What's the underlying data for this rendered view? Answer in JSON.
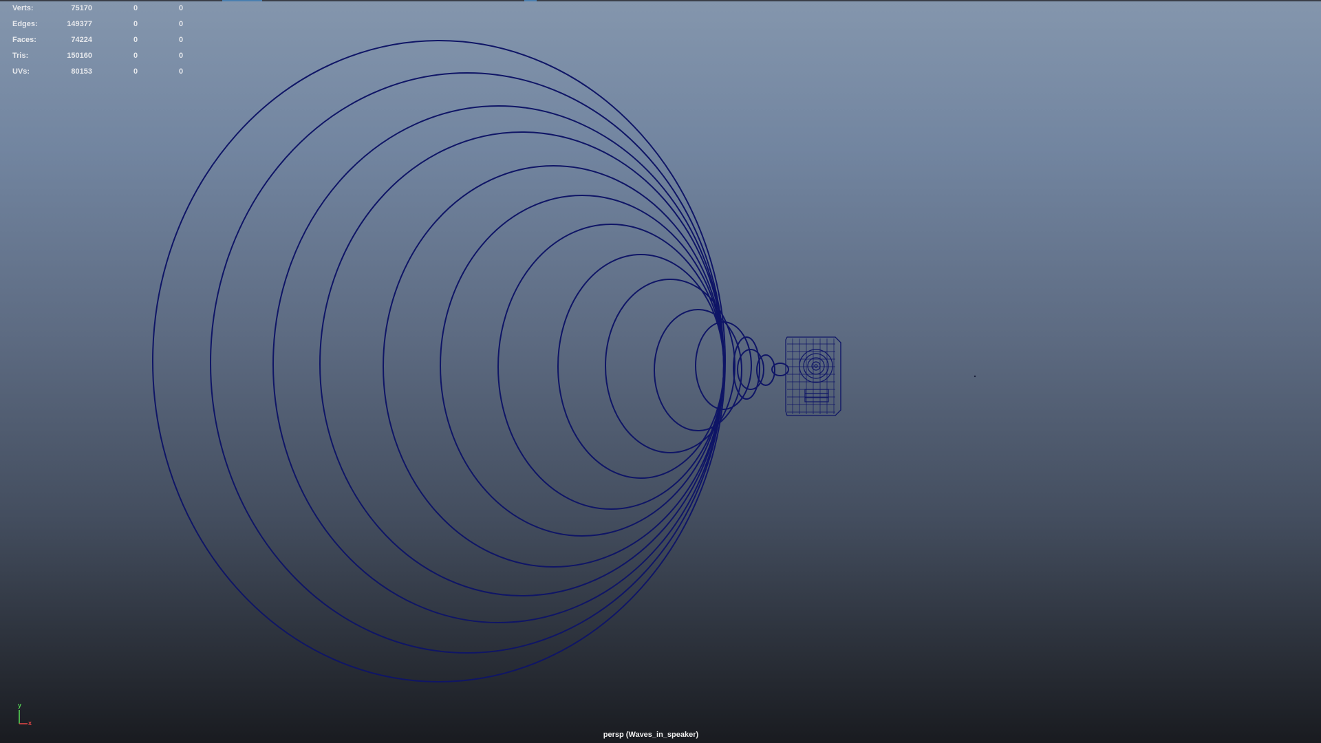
{
  "hud": {
    "rows": [
      {
        "label": "Verts:",
        "total": "75170",
        "selected": "0",
        "component": "0"
      },
      {
        "label": "Edges:",
        "total": "149377",
        "selected": "0",
        "component": "0"
      },
      {
        "label": "Faces:",
        "total": "74224",
        "selected": "0",
        "component": "0"
      },
      {
        "label": "Tris:",
        "total": "150160",
        "selected": "0",
        "component": "0"
      },
      {
        "label": "UVs:",
        "total": "80153",
        "selected": "0",
        "component": "0"
      }
    ]
  },
  "viewport": {
    "camera_label": "persp (Waves_in_speaker)",
    "axis": {
      "y": "y",
      "x": "x"
    }
  },
  "colors": {
    "wireframe": "#0f1566",
    "axis_y": "#55d455",
    "axis_x": "#e04545",
    "hud_text": "#e6e8ec"
  },
  "scene": {
    "objects": [
      "sound-wave-ring-set",
      "speaker-cabinet"
    ],
    "wave_ring_count": 15
  }
}
